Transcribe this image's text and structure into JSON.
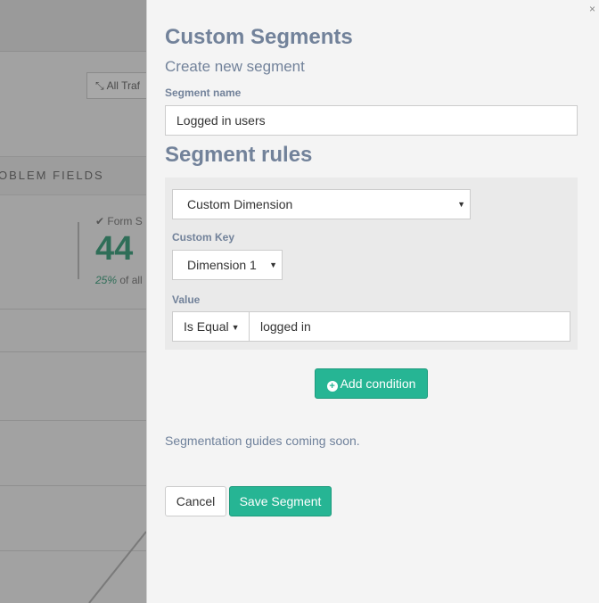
{
  "background": {
    "filter_button_label": "All Traf",
    "tab_label": "OBLEM FIELDS",
    "stat": {
      "label": "Form S",
      "value": "44",
      "percent": "25%",
      "percent_suffix": "of all"
    }
  },
  "panel": {
    "title": "Custom Segments",
    "subtitle": "Create new segment",
    "close_glyph": "×",
    "segment_name": {
      "label": "Segment name",
      "value": "Logged in users"
    },
    "rules_title": "Segment rules",
    "rule": {
      "type_value": "Custom Dimension",
      "custom_key_label": "Custom Key",
      "custom_key_value": "Dimension 1",
      "value_label": "Value",
      "operator_value": "Is Equal",
      "value_input": "logged in"
    },
    "add_condition_label": "Add condition",
    "guides_text": "Segmentation guides coming soon.",
    "cancel_label": "Cancel",
    "save_label": "Save Segment"
  },
  "colors": {
    "accent": "#26b594",
    "panel_text": "#72829a",
    "panel_bg": "#f4f4f4"
  }
}
